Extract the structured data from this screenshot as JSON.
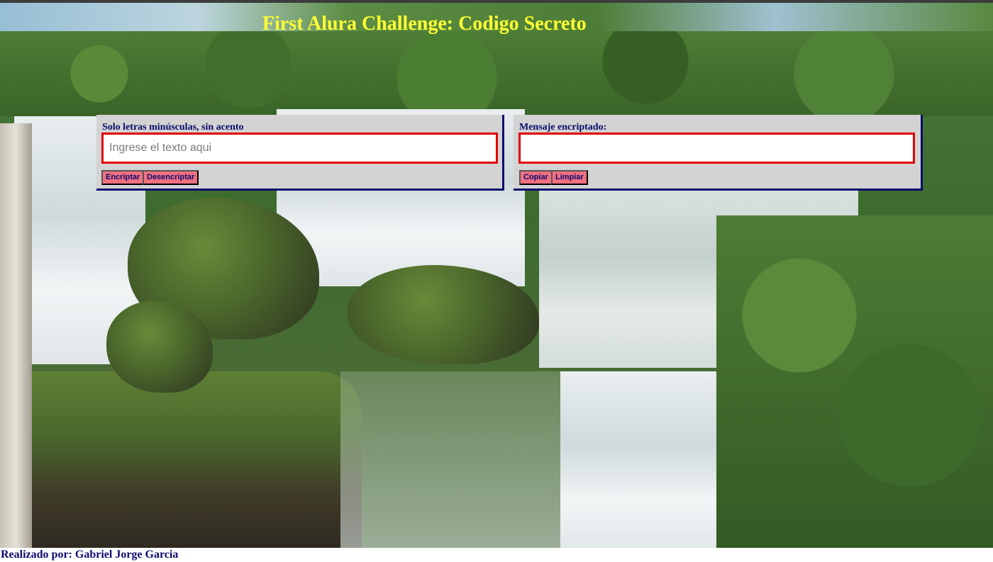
{
  "header": {
    "title": "First Alura Challenge: Codigo Secreto"
  },
  "background": {
    "image_icon": "waterfall-background-image"
  },
  "input_panel": {
    "label": "Solo letras minúsculas, sin acento",
    "input_value": "",
    "input_placeholder": "Ingrese el texto aqui",
    "encrypt_label": "Encriptar",
    "decrypt_label": "Desencriptar"
  },
  "output_panel": {
    "label": "Mensaje encriptado:",
    "output_value": "",
    "copy_label": "Copiar",
    "clear_label": "Limpiar"
  },
  "footer": {
    "credit": "Realizado por: Gabriel Jorge Garcia"
  },
  "colors": {
    "title": "#ffff33",
    "label": "#0a0a6e",
    "field_border": "#e00000",
    "button_bg": "#f07080",
    "panel_bg": "#d3d3d3"
  }
}
